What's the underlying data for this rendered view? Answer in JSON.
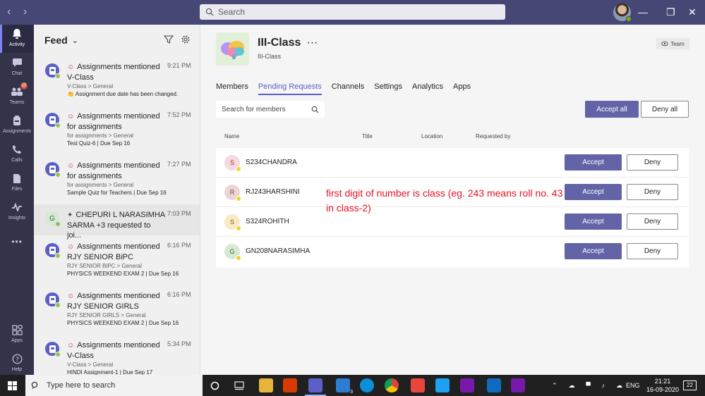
{
  "titlebar": {
    "search_placeholder": "Search",
    "back": "‹",
    "forward": "›",
    "minimize": "—",
    "maximize": "❐",
    "close": "✕"
  },
  "rail": {
    "items": [
      {
        "label": "Activity",
        "icon": "bell-icon"
      },
      {
        "label": "Chat",
        "icon": "chat-icon"
      },
      {
        "label": "Teams",
        "icon": "teams-icon",
        "badge": "@"
      },
      {
        "label": "Assignments",
        "icon": "assignments-icon"
      },
      {
        "label": "Calls",
        "icon": "phone-icon"
      },
      {
        "label": "Files",
        "icon": "file-icon"
      },
      {
        "label": "Insights",
        "icon": "insights-icon"
      },
      {
        "label": "Apps",
        "icon": "apps-icon"
      },
      {
        "label": "Help",
        "icon": "help-icon"
      }
    ],
    "more": "•••"
  },
  "feed": {
    "title": "Feed",
    "items": [
      {
        "title": "Assignments mentioned V-Class",
        "time": "9:21 PM",
        "sub": "V-Class > General",
        "detail": "👏 Assignment due date has been changed."
      },
      {
        "title": "Assignments mentioned for assignments",
        "time": "7:52 PM",
        "sub": "for assignments > General",
        "detail": "Test Quiz-6 | Due Sep 16"
      },
      {
        "title": "Assignments mentioned for assignments",
        "time": "7:27 PM",
        "sub": "for assignments > General",
        "detail": "Sample Quiz for Teachers | Due Sep 16"
      },
      {
        "title": "CHEPURI L NARASIMHA SARMA +3 requested to joi...",
        "time": "7:03 PM",
        "sub": "",
        "detail": "",
        "avatar": "G"
      },
      {
        "title": "Assignments mentioned RJY SENIOR BiPC",
        "time": "6:16 PM",
        "sub": "RJY SENIOR BiPC > General",
        "detail": "PHYSICS WEEKEND EXAM 2 | Due Sep 16"
      },
      {
        "title": "Assignments mentioned RJY SENIOR GIRLS",
        "time": "6:16 PM",
        "sub": "RJY SENIOR GIRLS > General",
        "detail": "PHYSICS WEEKEND EXAM 2 | Due Sep 16"
      },
      {
        "title": "Assignments mentioned V-Class",
        "time": "5:34 PM",
        "sub": "V-Class > General",
        "detail": "HINDI Assignment-1 | Due Sep 17"
      }
    ]
  },
  "team": {
    "name": "III-Class",
    "more": "···",
    "subtitle": "III-Class",
    "chip": "Team",
    "tabs": [
      "Members",
      "Pending Requests",
      "Channels",
      "Settings",
      "Analytics",
      "Apps"
    ],
    "active_tab": "Pending Requests",
    "member_search_placeholder": "Search for members",
    "accept_all": "Accept all",
    "deny_all": "Deny all",
    "columns": [
      "Name",
      "Title",
      "Location",
      "Requested by"
    ],
    "requests": [
      {
        "initial": "S",
        "name": "S234CHANDRA",
        "accept": "Accept",
        "deny": "Deny",
        "avatar_bg": "#f4d9df",
        "avatar_fg": "#a4262c"
      },
      {
        "initial": "R",
        "name": "RJ243HARSHINI",
        "accept": "Accept",
        "deny": "Deny",
        "avatar_bg": "#ecd5d5",
        "avatar_fg": "#8a3b3b"
      },
      {
        "initial": "S",
        "name": "S324ROHITH",
        "accept": "Accept",
        "deny": "Deny",
        "avatar_bg": "#fbe8c4",
        "avatar_fg": "#8a5a0a"
      },
      {
        "initial": "G",
        "name": "GN208NARASIMHA",
        "accept": "Accept",
        "deny": "Deny",
        "avatar_bg": "#d5e9d5",
        "avatar_fg": "#3b6a3b"
      }
    ],
    "annotation": "first digit of number is class (eg. 243 means roll no. 43 in class-2)"
  },
  "taskbar": {
    "search_placeholder": "Type here to search",
    "teams_badge": "3",
    "language": "ENG",
    "time": "21:21",
    "date": "16-09-2020",
    "notifications": "22"
  },
  "colors": {
    "accent": "#6264a7",
    "titlebar": "#464775",
    "rail": "#33344a",
    "annotation": "#e81123"
  }
}
